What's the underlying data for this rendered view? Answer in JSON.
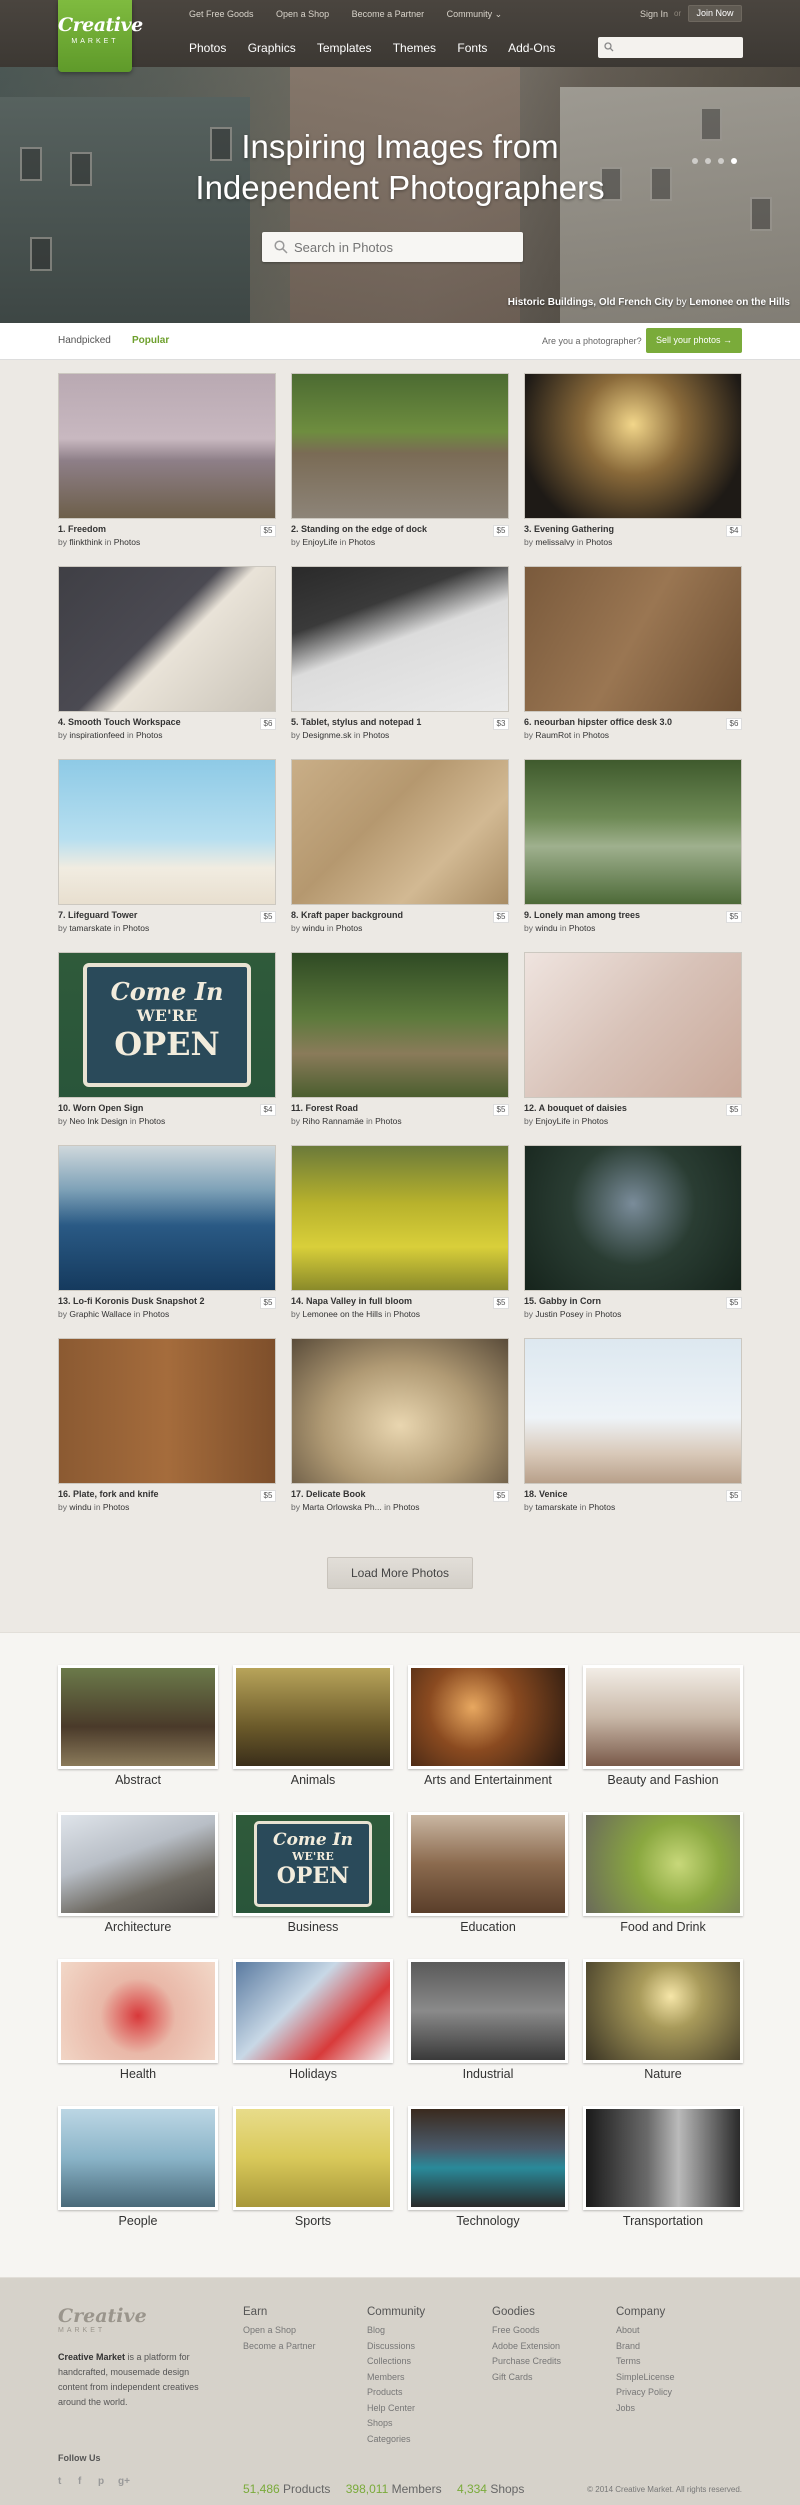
{
  "header": {
    "logo_line1": "Creative",
    "logo_line2": "MARKET",
    "top_links": [
      "Get Free Goods",
      "Open a Shop",
      "Become a Partner",
      "Community ⌄"
    ],
    "main_nav": [
      "Photos",
      "Graphics",
      "Templates",
      "Themes",
      "Fonts",
      "Add-Ons"
    ],
    "sign_in": "Sign In",
    "or": "or",
    "join": "Join Now"
  },
  "hero": {
    "title_line1": "Inspiring Images from",
    "title_line2": "Independent Photographers",
    "search_placeholder": "Search in Photos",
    "caption_title": "Historic Buildings, Old French City",
    "caption_by": "by",
    "caption_author": "Lemonee on the Hills",
    "slides": 4,
    "active_slide": 4
  },
  "tabs": {
    "handpicked": "Handpicked",
    "popular": "Popular",
    "photographer_prompt": "Are you a photographer?",
    "sell_button": "Sell your photos →"
  },
  "products": [
    {
      "title": "1. Freedom",
      "author": "flinkthink",
      "category": "Photos",
      "price": "$5"
    },
    {
      "title": "2. Standing on the edge of dock",
      "author": "EnjoyLife",
      "category": "Photos",
      "price": "$5"
    },
    {
      "title": "3. Evening Gathering",
      "author": "melissalvy",
      "category": "Photos",
      "price": "$4"
    },
    {
      "title": "4. Smooth Touch Workspace",
      "author": "inspirationfeed",
      "category": "Photos",
      "price": "$6"
    },
    {
      "title": "5. Tablet, stylus and notepad 1",
      "author": "Designme.sk",
      "category": "Photos",
      "price": "$3"
    },
    {
      "title": "6. neourban hipster office desk 3.0",
      "author": "RaumRot",
      "category": "Photos",
      "price": "$6"
    },
    {
      "title": "7. Lifeguard Tower",
      "author": "tamarskate",
      "category": "Photos",
      "price": "$5"
    },
    {
      "title": "8. Kraft paper background",
      "author": "windu",
      "category": "Photos",
      "price": "$5"
    },
    {
      "title": "9. Lonely man among trees",
      "author": "windu",
      "category": "Photos",
      "price": "$5"
    },
    {
      "title": "10. Worn Open Sign",
      "author": "Neo Ink Design",
      "category": "Photos",
      "price": "$4"
    },
    {
      "title": "11. Forest Road",
      "author": "Riho Rannamäe",
      "category": "Photos",
      "price": "$5"
    },
    {
      "title": "12. A bouquet of daisies",
      "author": "EnjoyLife",
      "category": "Photos",
      "price": "$5"
    },
    {
      "title": "13. Lo-fi Koronis Dusk Snapshot 2",
      "author": "Graphic Wallace",
      "category": "Photos",
      "price": "$5"
    },
    {
      "title": "14. Napa Valley in full bloom",
      "author": "Lemonee on the Hills",
      "category": "Photos",
      "price": "$5"
    },
    {
      "title": "15. Gabby in Corn",
      "author": "Justin Posey",
      "category": "Photos",
      "price": "$5"
    },
    {
      "title": "16. Plate, fork and knife",
      "author": "windu",
      "category": "Photos",
      "price": "$5"
    },
    {
      "title": "17. Delicate Book",
      "author": "Marta Orlowska Ph...",
      "category": "Photos",
      "price": "$5"
    },
    {
      "title": "18. Venice",
      "author": "tamarskate",
      "category": "Photos",
      "price": "$5"
    }
  ],
  "by_word": "by",
  "in_word": "in",
  "load_more": "Load More Photos",
  "categories": [
    "Abstract",
    "Animals",
    "Arts and Entertainment",
    "Beauty and Fashion",
    "Architecture",
    "Business",
    "Education",
    "Food and Drink",
    "Health",
    "Holidays",
    "Industrial",
    "Nature",
    "People",
    "Sports",
    "Technology",
    "Transportation"
  ],
  "footer": {
    "logo_line1": "Creative",
    "logo_line2": "MARKET",
    "desc_brand": "Creative Market",
    "desc_rest": " is a platform for handcrafted, mousemade design content from independent creatives around the world.",
    "columns": [
      {
        "title": "Earn",
        "links": [
          "Open a Shop",
          "Become a Partner"
        ]
      },
      {
        "title": "Community",
        "links": [
          "Blog",
          "Discussions",
          "Collections",
          "Members",
          "Products",
          "Help Center",
          "Shops",
          "Categories"
        ]
      },
      {
        "title": "Goodies",
        "links": [
          "Free Goods",
          "Adobe Extension",
          "Purchase Credits",
          "Gift Cards"
        ]
      },
      {
        "title": "Company",
        "links": [
          "About",
          "Brand",
          "Terms",
          "SimpleLicense",
          "Privacy Policy",
          "Jobs"
        ]
      }
    ],
    "follow_us": "Follow Us",
    "social": [
      "twitter-icon",
      "facebook-icon",
      "pinterest-icon",
      "google-plus-icon"
    ],
    "stats": [
      {
        "num": "51,486",
        "label": "Products"
      },
      {
        "num": "398,011",
        "label": "Members"
      },
      {
        "num": "4,334",
        "label": "Shops"
      }
    ],
    "copyright": "© 2014 Creative Market. All rights reserved."
  },
  "colors": {
    "brand_green": "#7aab3a",
    "header_bg": "#3c3833",
    "page_bg": "#ece9e4",
    "footer_bg": "#d6d2ca"
  }
}
